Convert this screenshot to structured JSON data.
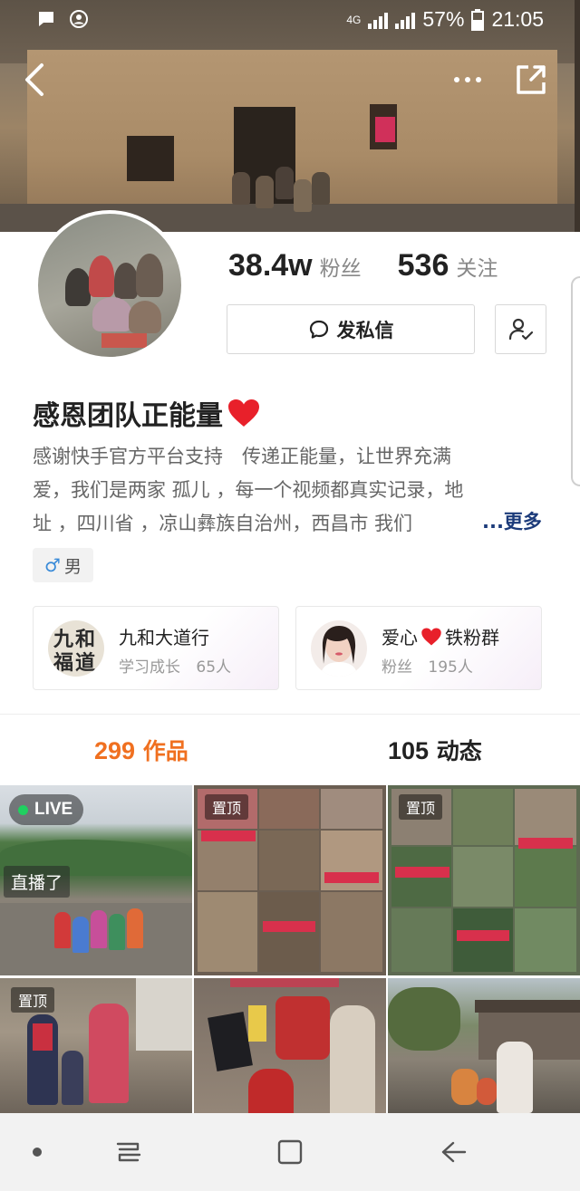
{
  "status_bar": {
    "network_label": "4G",
    "battery": "57%",
    "time": "21:05"
  },
  "profile": {
    "followers_count": "38.4w",
    "followers_label": "粉丝",
    "following_count": "536",
    "following_label": "关注",
    "message_button": "发私信",
    "name": "感恩团队正能量",
    "bio_lines": [
      "感谢快手官方平台支持　传递正能量，让世界充满",
      "爱，我们是两家 孤儿 ，每一个视频都真实记录，地",
      "址 ，四川省 ，凉山彝族自治州，西昌市 我们"
    ],
    "bio_more": "...更多",
    "gender": "男"
  },
  "groups": [
    {
      "title": "九和大道行",
      "category": "学习成长",
      "count": "65人"
    },
    {
      "title_prefix": "爱心",
      "title_suffix": "铁粉群",
      "category": "粉丝",
      "count": "195人"
    }
  ],
  "tabs": {
    "works_count": "299",
    "works_label": "作品",
    "moments_count": "105",
    "moments_label": "动态"
  },
  "grid": {
    "live_label": "LIVE",
    "streaming_label": "直播了",
    "pinned_label": "置顶"
  },
  "colors": {
    "accent_orange": "#f07020",
    "link_blue": "#1c3b7a",
    "live_green": "#20d060",
    "heart_red": "#e8202a"
  },
  "icons": {
    "back": "back-arrow-icon",
    "more": "more-dots-icon",
    "share": "share-icon",
    "message": "chat-bubble-icon",
    "follow": "person-check-icon"
  }
}
